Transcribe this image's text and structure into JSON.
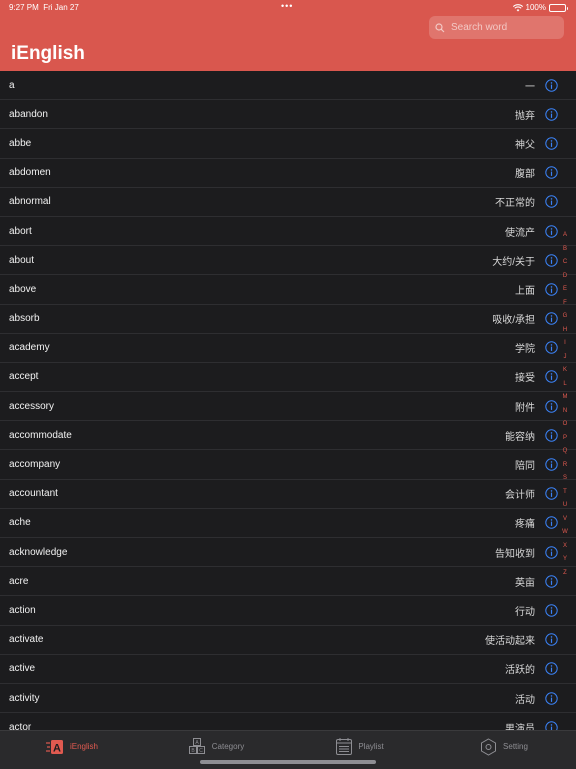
{
  "status_bar": {
    "time": "9:27 PM",
    "date": "Fri Jan 27",
    "battery": "100%"
  },
  "search": {
    "placeholder": "Search word"
  },
  "app": {
    "title": "iEnglish"
  },
  "colors": {
    "header": "#d9574e",
    "accent": "#e05a50",
    "info": "#3b82f6",
    "background": "#1c1c1e"
  },
  "words": [
    {
      "word": "a",
      "meaning": "一"
    },
    {
      "word": "abandon",
      "meaning": "抛弃"
    },
    {
      "word": "abbe",
      "meaning": "神父"
    },
    {
      "word": "abdomen",
      "meaning": "腹部"
    },
    {
      "word": "abnormal",
      "meaning": "不正常的"
    },
    {
      "word": "abort",
      "meaning": "使流产"
    },
    {
      "word": "about",
      "meaning": "大约/关于"
    },
    {
      "word": "above",
      "meaning": "上面"
    },
    {
      "word": "absorb",
      "meaning": "吸收/承担"
    },
    {
      "word": "academy",
      "meaning": "学院"
    },
    {
      "word": "accept",
      "meaning": "接受"
    },
    {
      "word": "accessory",
      "meaning": "附件"
    },
    {
      "word": "accommodate",
      "meaning": "能容纳"
    },
    {
      "word": "accompany",
      "meaning": "陪同"
    },
    {
      "word": "accountant",
      "meaning": "会计师"
    },
    {
      "word": "ache",
      "meaning": "疼痛"
    },
    {
      "word": "acknowledge",
      "meaning": "告知收到"
    },
    {
      "word": "acre",
      "meaning": "英亩"
    },
    {
      "word": "action",
      "meaning": "行动"
    },
    {
      "word": "activate",
      "meaning": "使活动起来"
    },
    {
      "word": "active",
      "meaning": "活跃的"
    },
    {
      "word": "activity",
      "meaning": "活动"
    },
    {
      "word": "actor",
      "meaning": "男演员"
    }
  ],
  "index_letters": [
    "A",
    "B",
    "C",
    "D",
    "E",
    "F",
    "G",
    "H",
    "I",
    "J",
    "K",
    "L",
    "M",
    "N",
    "O",
    "P",
    "Q",
    "R",
    "S",
    "T",
    "U",
    "V",
    "W",
    "X",
    "Y",
    "Z"
  ],
  "tabs": [
    {
      "label": "iEnglish",
      "icon": "a-letter-icon"
    },
    {
      "label": "Category",
      "icon": "blocks-icon"
    },
    {
      "label": "Playlist",
      "icon": "list-icon"
    },
    {
      "label": "Setting",
      "icon": "gear-icon"
    }
  ]
}
